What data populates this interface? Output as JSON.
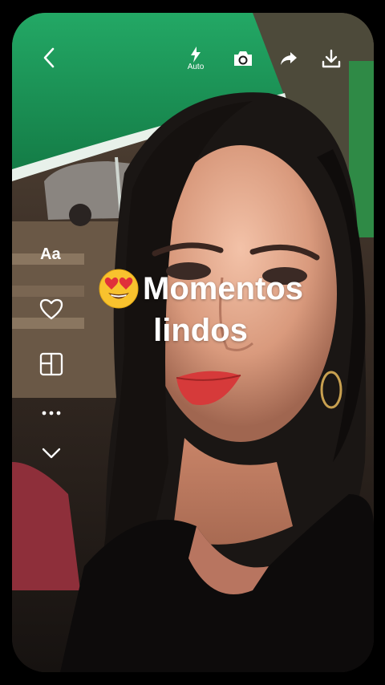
{
  "top_bar": {
    "back_icon": "chevron-left-icon",
    "flash_icon": "flash-icon",
    "flash_label": "Auto",
    "camera_icon": "camera-icon",
    "share_icon": "share-arrow-icon",
    "download_icon": "download-icon"
  },
  "side_tools": {
    "text_label": "Aa",
    "items": [
      {
        "icon": "heart-icon"
      },
      {
        "icon": "layout-grid-icon"
      },
      {
        "icon": "more-dots-icon"
      },
      {
        "icon": "chevron-down-icon"
      }
    ]
  },
  "caption": {
    "emoji": "heart-eyes-emoji",
    "line1": "Momentos",
    "line2": "lindos"
  },
  "colors": {
    "awning_green": "#1f9a5a",
    "lip_red": "#d63a3a",
    "background": "#000000",
    "foreground": "#ffffff"
  }
}
